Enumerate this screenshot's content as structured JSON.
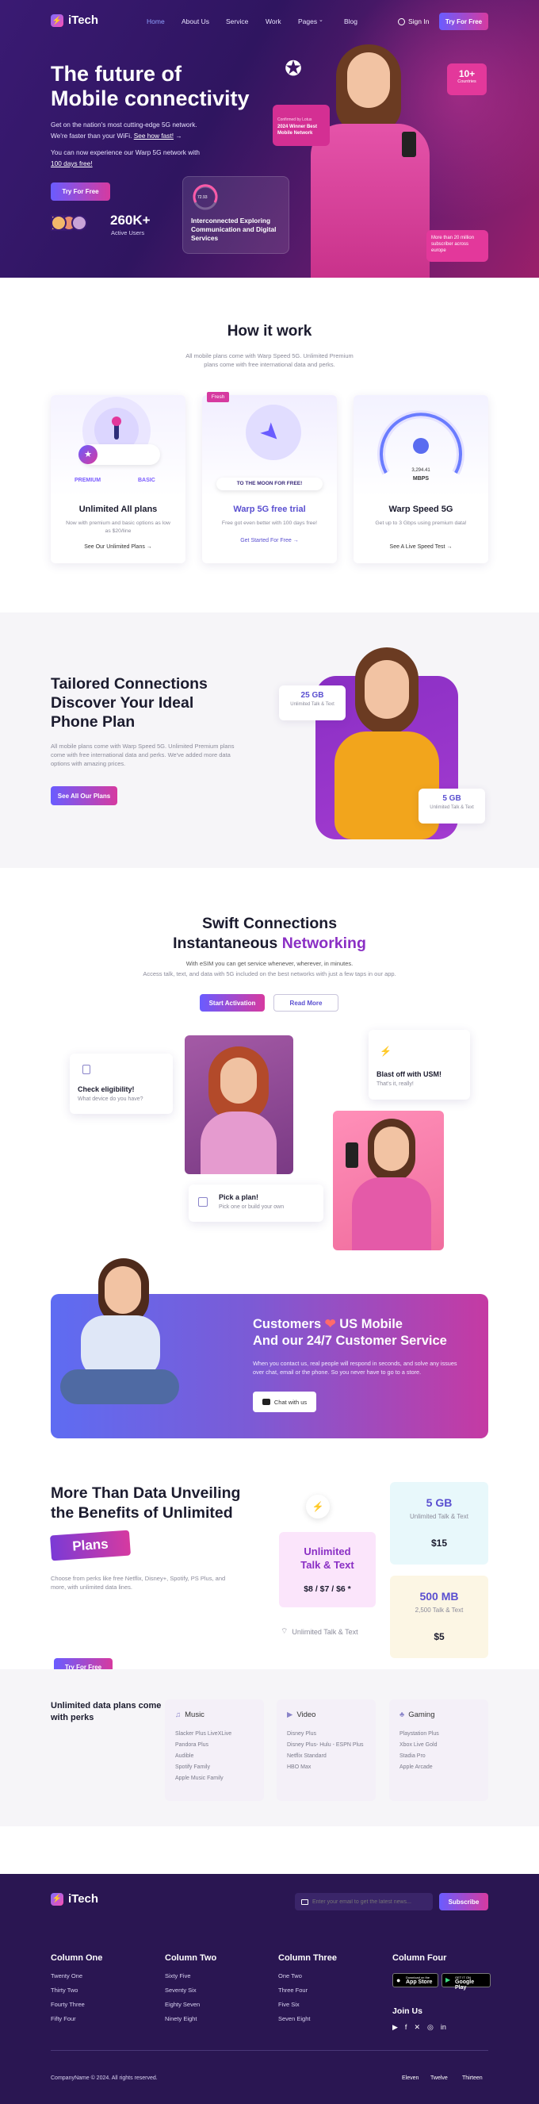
{
  "nav": {
    "brand": "iTech",
    "links": [
      "Home",
      "About Us",
      "Service",
      "Work",
      "Pages",
      "Blog"
    ],
    "signin": "Sign In",
    "cta": "Try For Free"
  },
  "hero": {
    "title1": "The future of",
    "title2": "Mobile connectivity",
    "p1a": "Get on the nation's most cutting-edge 5G network.",
    "p1b": "We're faster than your WiFi.",
    "p1link": "See how fast!",
    "p2a": "You can now experience our Warp 5G network with",
    "p2link": "100 days free!",
    "cta": "Try For Free",
    "users_count": "260K+",
    "users_label": "Active Users",
    "speed_value": "72.93",
    "speed_caption": "Interconnected Exploring Communication and Digital Services",
    "award_small": "Confirmed by Lotus",
    "award_title": "2024 Winner Best Mobile Network",
    "countries_count": "10+",
    "countries_label": "Countries",
    "subscribers": "More than 20 million subscriber across europe"
  },
  "how": {
    "title": "How it work",
    "sub1": "All mobile plans come with Warp Speed 5G. Unlimited Premium",
    "sub2": "plans come with free international data and perks.",
    "cards": [
      {
        "title": "Unlimited All plans",
        "desc": "Now with premium and basic options as low as $20/line",
        "link": "See Our Unlimited Plans",
        "tag1": "PREMIUM",
        "tag2": "BASIC"
      },
      {
        "title": "Warp 5G free trial",
        "desc": "Free got even better with 100 days free!",
        "link": "Get Started For Free",
        "badge": "Fresh",
        "banner": "TO THE MOON FOR FREE!"
      },
      {
        "title": "Warp Speed 5G",
        "desc": "Get up to 3 Gbps using premium data!",
        "link": "See A Live Speed Test",
        "gauge_value": "3,294.41",
        "gauge_unit": "MBPS"
      }
    ]
  },
  "tailored": {
    "title1": "Tailored Connections",
    "title2": "Discover Your Ideal",
    "title3": "Phone Plan",
    "desc": "All mobile plans come with Warp Speed 5G. Unlimited Premium plans come with free international data and perks. We've added more data options with amazing prices.",
    "cta": "See All Our Plans",
    "badge1_value": "25 GB",
    "badge1_label": "Unlimited Talk & Text",
    "badge2_value": "5 GB",
    "badge2_label": "Unlimited Talk & Text"
  },
  "swift": {
    "title1": "Swift Connections",
    "title2a": "Instantaneous",
    "title2b": "Networking",
    "sub": "With eSIM you can get service whenever, wherever, in minutes.",
    "sub2": "Access talk, text, and data with 5G included on the best networks with just a few taps in our app.",
    "btn1": "Start Activation",
    "btn2": "Read More",
    "step1_title": "Check eligibility!",
    "step1_desc": "What device do you have?",
    "step2_title": "Pick a plan!",
    "step2_desc": "Pick one or build your own",
    "step3_title": "Blast off with USM!",
    "step3_desc": "That's it, really!"
  },
  "support": {
    "title1": "Customers",
    "title1b": "US Mobile",
    "title2": "And our 24/7 Customer Service",
    "desc": "When you contact us, real people will respond in seconds, and solve any issues over chat, email or the phone. So you never have to go to a store.",
    "cta": "Chat with us"
  },
  "benefits": {
    "title1": "More Than Data Unveiling",
    "title2": "the Benefits of Unlimited",
    "tag": "Plans",
    "desc": "Choose from perks like free Netflix, Disney+, Spotify, PS Plus, and more, with unlimited data lines.",
    "cta": "Try For Free",
    "plan1_title": "Unlimited Talk & Text",
    "plan1_price": "$8 / $7 / $6 *",
    "plan2_title": "5 GB",
    "plan2_sub": "Unlimited Talk & Text",
    "plan2_price": "$15",
    "plan3_title": "500 MB",
    "plan3_sub": "2,500 Talk & Text",
    "plan3_price": "$5",
    "unlimited_note": "Unlimited Talk & Text"
  },
  "perks": {
    "title": "Unlimited data plans come with perks",
    "music": {
      "title": "Music",
      "items": [
        "Slacker Plus LiveXLive",
        "Pandora Plus",
        "Audible",
        "Spotify Family",
        "Apple Music Family"
      ]
    },
    "video": {
      "title": "Video",
      "items": [
        "Disney Plus",
        "Disney Plus- Hulu - ESPN Plus",
        "Netflix Standard",
        "HBO Max"
      ]
    },
    "gaming": {
      "title": "Gaming",
      "items": [
        "Playstation Plus",
        "Xbox Live Gold",
        "Stadia Pro",
        "Apple Arcade"
      ]
    }
  },
  "footer": {
    "brand": "iTech",
    "email_placeholder": "Enter your email to get the latest news...",
    "subscribe": "Subscribe",
    "col1": {
      "title": "Column One",
      "items": [
        "Twenty One",
        "Thirty Two",
        "Fourty Three",
        "Fifty Four"
      ]
    },
    "col2": {
      "title": "Column Two",
      "items": [
        "Sixty Five",
        "Seventy Six",
        "Eighty Seven",
        "Ninety Eight"
      ]
    },
    "col3": {
      "title": "Column Three",
      "items": [
        "One Two",
        "Three Four",
        "Five Six",
        "Seven Eight"
      ]
    },
    "col4": {
      "title": "Column Four"
    },
    "appstore_small": "Download on the",
    "appstore": "App Store",
    "gplay_small": "GET IT ON",
    "gplay": "Google Play",
    "join": "Join Us",
    "copyright": "CompanyName © 2024. All rights reserved.",
    "links": [
      "Eleven",
      "Twelve",
      "Thirteen"
    ]
  },
  "colors": {
    "primary": "#6a5cff",
    "accent": "#d63aa0",
    "dark": "#2a1652",
    "purple": "#8a2fc4"
  }
}
